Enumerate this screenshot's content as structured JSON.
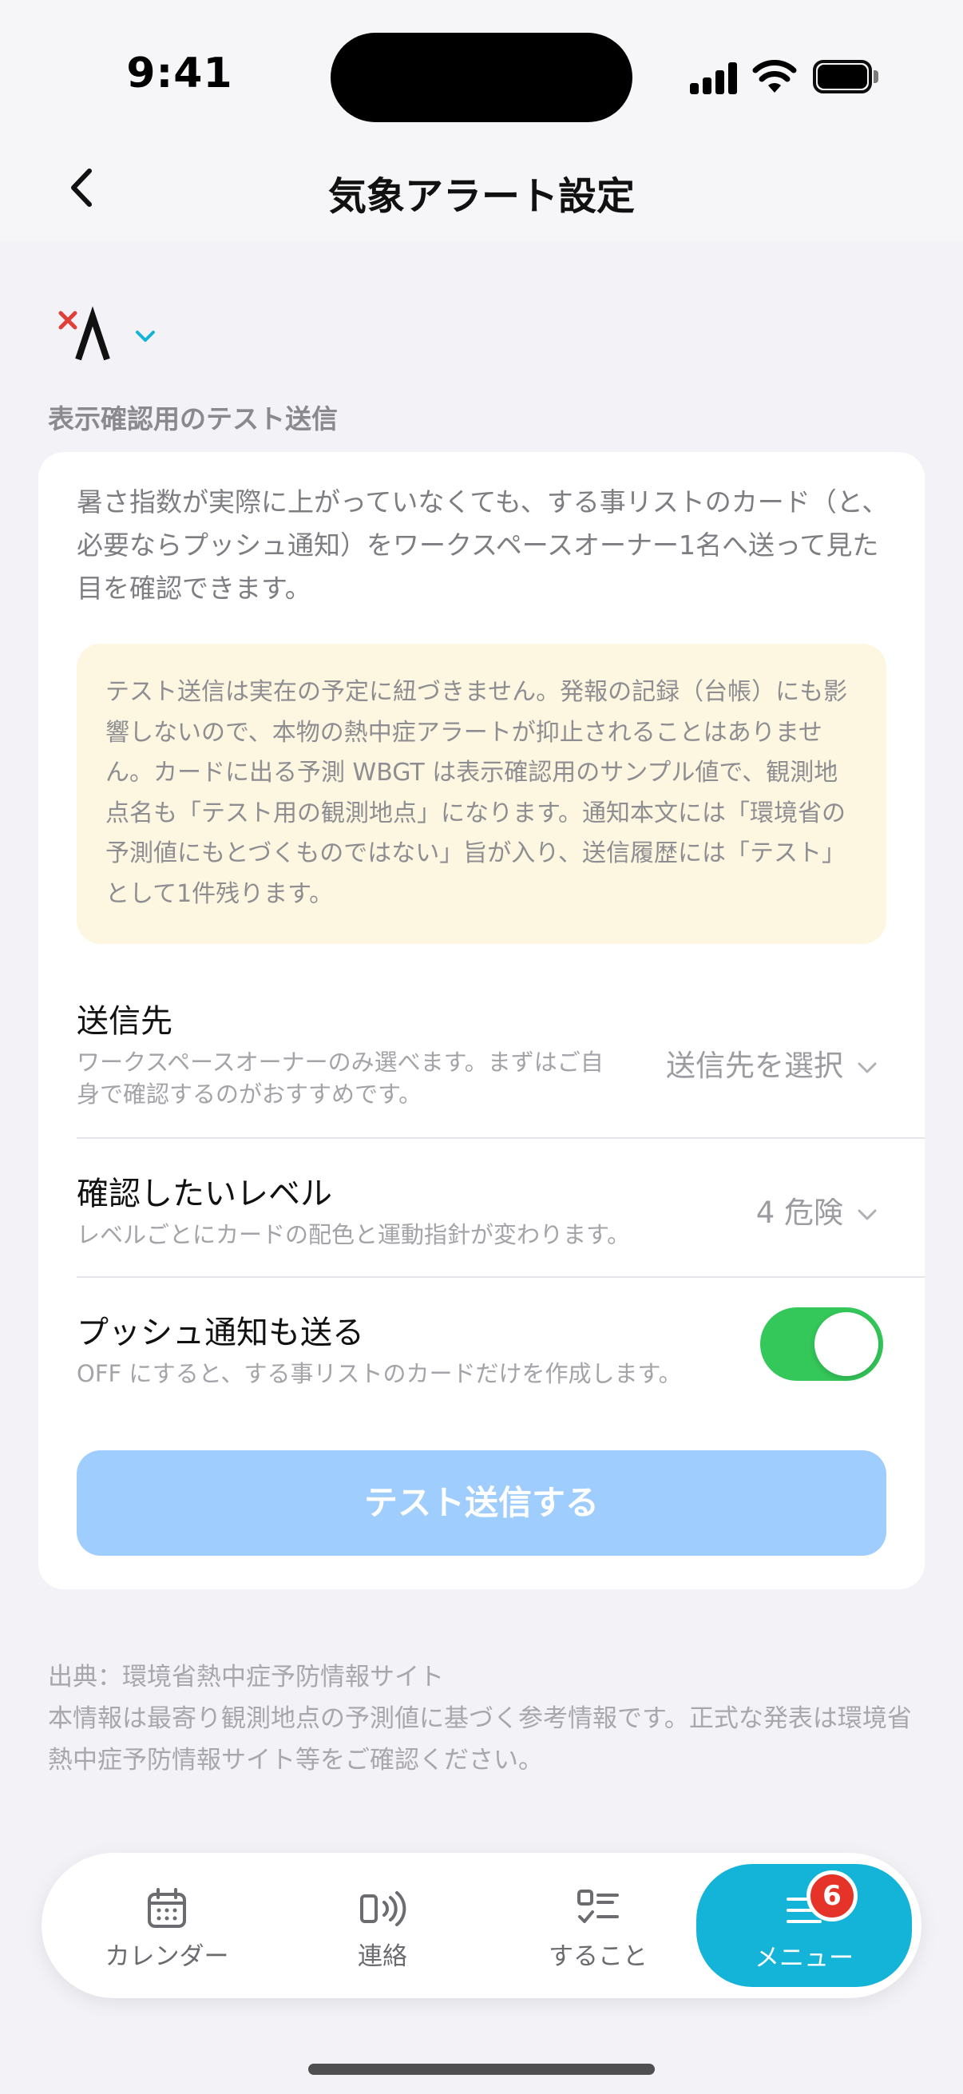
{
  "status_bar": {
    "time": "9:41"
  },
  "nav": {
    "title": "気象アラート設定",
    "back_icon": "chevron-left-icon"
  },
  "workspace": {
    "logo_icon": "workspace-logo-icon",
    "dropdown_icon": "chevron-down-icon"
  },
  "section": {
    "label": "表示確認用のテスト送信"
  },
  "card": {
    "intro": "暑さ指数が実際に上がっていなくても、する事リストのカード（と、必要ならプッシュ通知）をワークスペースオーナー1名へ送って見た目を確認できます。",
    "notice": "テスト送信は実在の予定に紐づきません。発報の記録（台帳）にも影響しないので、本物の熱中症アラートが抑止されることはありません。カードに出る予測 WBGT は表示確認用のサンプル値で、観測地点名も「テスト用の観測地点」になります。通知本文には「環境省の予測値にもとづくものではない」旨が入り、送信履歴には「テスト」として1件残ります。",
    "recipient": {
      "title": "送信先",
      "description": "ワークスペースオーナーのみ選べます。まずはご自身で確認するのがおすすめです。",
      "value": "送信先を選択"
    },
    "level": {
      "title": "確認したいレベル",
      "description": "レベルごとにカードの配色と運動指針が変わります。",
      "value": "4 危険"
    },
    "push": {
      "title": "プッシュ通知も送る",
      "description": "OFF にすると、する事リストのカードだけを作成します。",
      "enabled": true
    },
    "submit_label": "テスト送信する"
  },
  "footnote": {
    "source": "出典：環境省熱中症予防情報サイト",
    "disclaimer": "本情報は最寄り観測地点の予測値に基づく参考情報です。正式な発表は環境省熱中症予防情報サイト等をご確認ください。"
  },
  "tab_bar": {
    "tabs": [
      {
        "label": "カレンダー",
        "icon": "calendar-icon"
      },
      {
        "label": "連絡",
        "icon": "broadcast-icon"
      },
      {
        "label": "すること",
        "icon": "checklist-icon"
      },
      {
        "label": "メニュー",
        "icon": "menu-icon",
        "badge": "6",
        "active": true
      }
    ]
  },
  "colors": {
    "accent": "#14b4d8",
    "toggle_on": "#34c759",
    "button_disabled": "#9fcdfd",
    "notice_bg": "#fdf6e1",
    "badge": "#e5332a"
  }
}
